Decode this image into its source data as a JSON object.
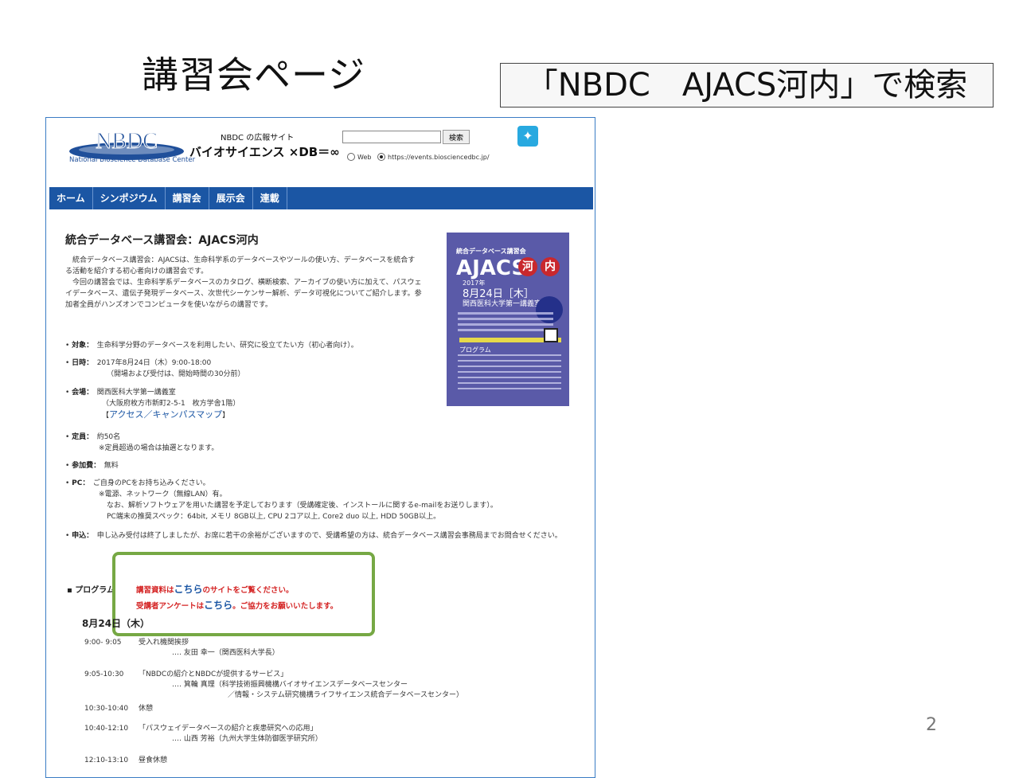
{
  "slide": {
    "title": "講習会ページ",
    "search_hint": "「NBDC　AJACS河内」で検索",
    "page_number": "2"
  },
  "site": {
    "logo_text": "NBDC",
    "logo_subtitle": "National Bioscience Database Center",
    "tagline": "NBDC の広報サイト",
    "name": "バイオサイエンス ×DB＝∞",
    "search_button": "検索",
    "search_value": "",
    "radio_web": "Web",
    "radio_site": "https://events.biosciencedbc.jp/",
    "twitter_icon": "twitter-icon"
  },
  "nav": [
    "ホーム",
    "シンポジウム",
    "講習会",
    "展示会",
    "連載"
  ],
  "article": {
    "title": "統合データベース講習会：AJACS河内",
    "intro_1": "統合データベース講習会：AJACSは、生命科学系のデータベースやツールの使い方、データベースを統合する活動を紹介する初心者向けの講習会です。",
    "intro_2": "今回の講習会では、生命科学系データベースのカタログ、横断検索、アーカイブの使い方に加えて、パスウェイデータベース、遺伝子発現データベース、次世代シーケンサー解析、データ可視化についてご紹介します。参加者全員がハンズオンでコンピュータを使いながらの講習です。"
  },
  "flyer": {
    "head": "統合データベース講習会",
    "title": "AJACS",
    "kawa": "河",
    "uchi": "内",
    "year": "2017年",
    "date": "8月24日［木］",
    "venue": "関西医科大学第一講義室",
    "program": "プログラム"
  },
  "details": {
    "target_label": "対象：",
    "target": "生命科学分野のデータベースを利用したい、研究に役立てたい方（初心者向け）。",
    "date_label": "日時：",
    "date": "2017年8月24日（木）9:00-18:00",
    "date_note": "（開場および受付は、開始時間の30分前）",
    "venue_label": "会場：",
    "venue": "関西医科大学第一講義室",
    "venue_address": "（大阪府枚方市新町2-5-1　枚方学舎1階）",
    "venue_link": "アクセス／キャンパスマップ",
    "capacity_label": "定員：",
    "capacity": "約50名",
    "capacity_note": "※定員超過の場合は抽選となります。",
    "fee_label": "参加費：",
    "fee": "無料",
    "pc_label": "PC：",
    "pc": "ご自身のPCをお持ち込みください。",
    "pc_note1": "※電源、ネットワーク（無線LAN）有。",
    "pc_note2": "なお、解析ソフトウェアを用いた講習を予定しております（受講確定後、インストールに関するe-mailをお送りします）。",
    "pc_note3": "PC端末の推奨スペック：64bit, メモリ 8GB以上, CPU 2コア以上, Core2 duo 以上, HDD 50GB以上。",
    "apply_label": "申込：",
    "apply": "申し込み受付は終了しましたが、お席に若干の余裕がございますので、受講希望の方は、統合データベース講習会事務局までお問合せください。"
  },
  "program": {
    "label": "プログラム",
    "notice_1_pre": "講習資料は",
    "notice_1_link": "こちら",
    "notice_1_post": "のサイトをご覧ください。",
    "notice_2_pre": "受講者アンケートは",
    "notice_2_link": "こちら",
    "notice_2_post": "。ご協力をお願いいたします。",
    "day": "8月24日（木）",
    "rows": [
      {
        "time": "9:00- 9:05",
        "title": "受入れ機関挨拶",
        "speaker": "‥‥ 友田 幸一（関西医科大学長）"
      },
      {
        "time": "9:05-10:30",
        "title": "「NBDCの紹介とNBDCが提供するサービス」",
        "speaker": "‥‥ 箕輪 真理（科学技術振興機構バイオサイエンスデータベースセンター",
        "speaker2": "／情報・システム研究機構ライフサイエンス統合データベースセンター）"
      },
      {
        "time": "10:30-10:40",
        "title": "休憩"
      },
      {
        "time": "10:40-12:10",
        "title": "「パスウェイデータベースの紹介と疾患研究への応用」",
        "speaker": "‥‥ 山西 芳裕（九州大学生体防御医学研究所）"
      },
      {
        "time": "12:10-13:10",
        "title": "昼食休憩"
      }
    ]
  }
}
